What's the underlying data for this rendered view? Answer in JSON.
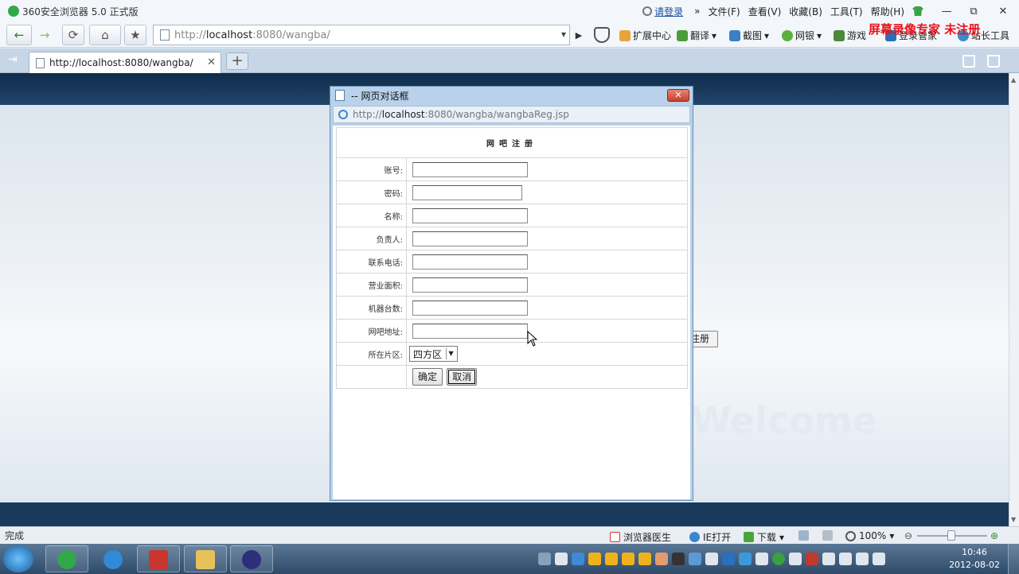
{
  "browser": {
    "app_title": "360安全浏览器 5.0 正式版",
    "login_label": "请登录",
    "menu": [
      "文件(F)",
      "查看(V)",
      "收藏(B)",
      "工具(T)",
      "帮助(H)"
    ],
    "window_controls": {
      "minimize": "—",
      "restore": "⧉",
      "close": "✕"
    },
    "address": {
      "prefix": "http://",
      "host": "localhost",
      "rest": ":8080/wangba/"
    },
    "toolbar": {
      "extensions": "扩展中心",
      "translate": "翻译",
      "screenshot": "截图",
      "netbank": "网银",
      "games": "游戏",
      "login_manager": "登录管家",
      "webmaster_tools": "站长工具"
    },
    "watermark": "屏幕录像专家 未注册",
    "tab": {
      "title": "http://localhost:8080/wangba/",
      "close": "✕"
    },
    "new_tab": "+"
  },
  "page": {
    "welcome_text": "Welcome",
    "register_button_partial": "注册"
  },
  "dialog": {
    "title": "-- 网页对话框",
    "close": "✕",
    "url": {
      "prefix": "http://",
      "host": "localhost",
      "rest": ":8080/wangba/wangbaReg.jsp"
    },
    "form": {
      "heading": "网吧注册",
      "fields": [
        {
          "label": "账号:",
          "value": ""
        },
        {
          "label": "密码:",
          "value": ""
        },
        {
          "label": "名称:",
          "value": ""
        },
        {
          "label": "负责人:",
          "value": ""
        },
        {
          "label": "联系电话:",
          "value": ""
        },
        {
          "label": "营业面积:",
          "value": ""
        },
        {
          "label": "机器台数:",
          "value": ""
        },
        {
          "label": "网吧地址:",
          "value": ""
        }
      ],
      "district_label": "所在片区:",
      "district_selected": "四方区",
      "confirm_button": "确定",
      "cancel_button": "取消"
    }
  },
  "statusbar": {
    "status": "完成",
    "doctor": "浏览器医生",
    "ie_open": "IE打开",
    "download": "下载",
    "zoom": "100%",
    "zoom_level_percent": 100
  },
  "taskbar": {
    "time": "10:46",
    "date": "2012-08-02"
  },
  "colors": {
    "accent_green": "#31a84a",
    "watermark_red": "#e8121b",
    "page_header": "#0f2c4a",
    "dialog_frame": "#b9d1ea"
  }
}
